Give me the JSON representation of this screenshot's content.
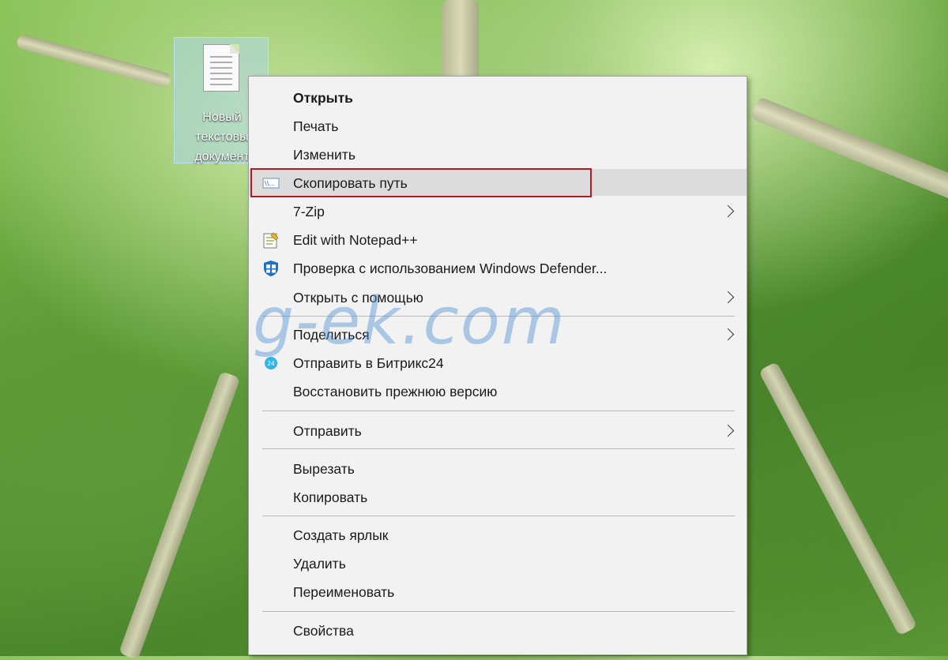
{
  "desktop": {
    "file_icon_name": "text-file-icon",
    "file_label_lines": [
      "Новый",
      "текстовы",
      "документ"
    ]
  },
  "context_menu": {
    "items": [
      {
        "label": "Открыть",
        "bold": true
      },
      {
        "label": "Печать"
      },
      {
        "label": "Изменить"
      },
      {
        "label": "Скопировать путь",
        "icon": "copy-path-icon",
        "highlighted": true
      },
      {
        "label": "7-Zip",
        "submenu": true
      },
      {
        "label": "Edit with Notepad++",
        "icon": "notepad-plus-plus-icon"
      },
      {
        "label": "Проверка с использованием Windows Defender...",
        "icon": "windows-defender-icon"
      },
      {
        "label": "Открыть с помощью",
        "submenu": true
      },
      {
        "label": "Поделиться",
        "submenu": true
      },
      {
        "label": "Отправить в Битрикс24",
        "icon": "bitrix24-icon"
      },
      {
        "label": "Восстановить прежнюю версию"
      },
      {
        "label": "Отправить",
        "submenu": true
      },
      {
        "label": "Вырезать"
      },
      {
        "label": "Копировать"
      },
      {
        "label": "Создать ярлык"
      },
      {
        "label": "Удалить"
      },
      {
        "label": "Переименовать"
      },
      {
        "label": "Свойства"
      }
    ]
  },
  "watermark": "g-ek.com",
  "colors": {
    "highlight_border": "#b01e24",
    "menu_background": "#f2f2f2",
    "hover_background": "#dcdcdc"
  }
}
